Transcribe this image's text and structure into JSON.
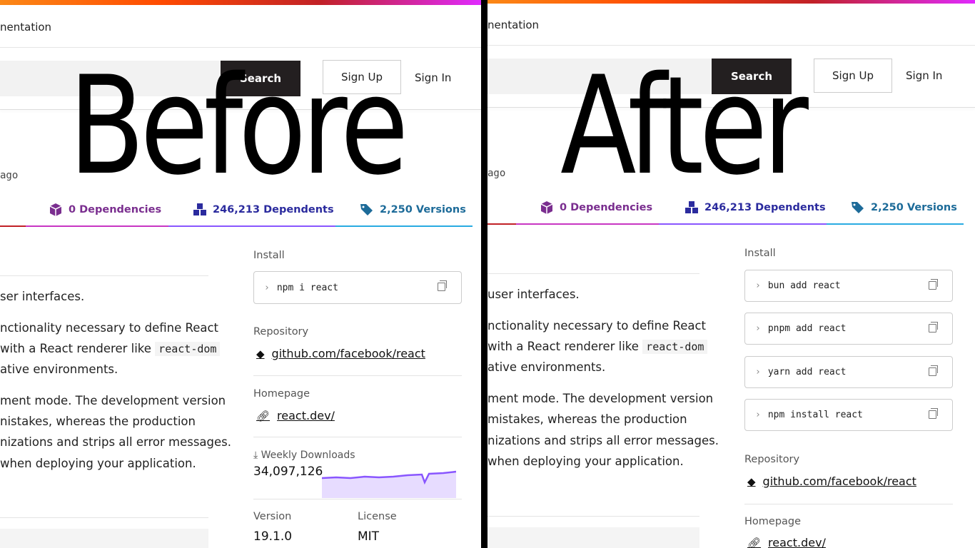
{
  "labels": {
    "before": "Before",
    "after": "After"
  },
  "header": {
    "doc_link_fragment": "nentation",
    "search_button": "Search",
    "sign_up": "Sign Up",
    "sign_in": "Sign In"
  },
  "meta": {
    "ago": "ago"
  },
  "tabs": {
    "dependencies": "0 Dependencies",
    "dependents": "246,213 Dependents",
    "versions": "2,250 Versions"
  },
  "readme": {
    "line1": "ser interfaces.",
    "line2": "nctionality necessary to define React",
    "line3a": "with a React renderer like ",
    "line3_code": "react-dom",
    "line4": "ative environments.",
    "line5": "ment mode. The development version",
    "line6": "nistakes, whereas the production",
    "line7": "nizations and strips all error messages.",
    "line8": "when deploying your application."
  },
  "readme_after": {
    "line1": "user interfaces.",
    "line2": "nctionality necessary to define React",
    "line3a": "with a React renderer like ",
    "line3_code": "react-dom",
    "line4": "ative environments.",
    "line5": "ment mode. The development version",
    "line6": "mistakes, whereas the production",
    "line7": "nizations and strips all error messages.",
    "line8": "when deploying your application."
  },
  "sidebar_before": {
    "install_label": "Install",
    "install_cmds": [
      "npm i react"
    ],
    "repo_label": "Repository",
    "repo_link": "github.com/facebook/react",
    "home_label": "Homepage",
    "home_link": "react.dev/",
    "weekly_label": "Weekly Downloads",
    "weekly_value": "34,097,126",
    "version_label": "Version",
    "version_value": "19.1.0",
    "license_label": "License",
    "license_value": "MIT"
  },
  "sidebar_after": {
    "install_label": "Install",
    "install_cmds": [
      "bun add react",
      "pnpm add react",
      "yarn add react",
      "npm install react"
    ],
    "repo_label": "Repository",
    "repo_link": "github.com/facebook/react",
    "home_label": "Homepage",
    "home_link": "react.dev/"
  },
  "colors": {
    "deps": "#7a2e8f",
    "dependents": "#2b2b9e",
    "versions": "#1d6b99",
    "spark_line": "#8956ff",
    "spark_fill": "#e7dcff"
  }
}
